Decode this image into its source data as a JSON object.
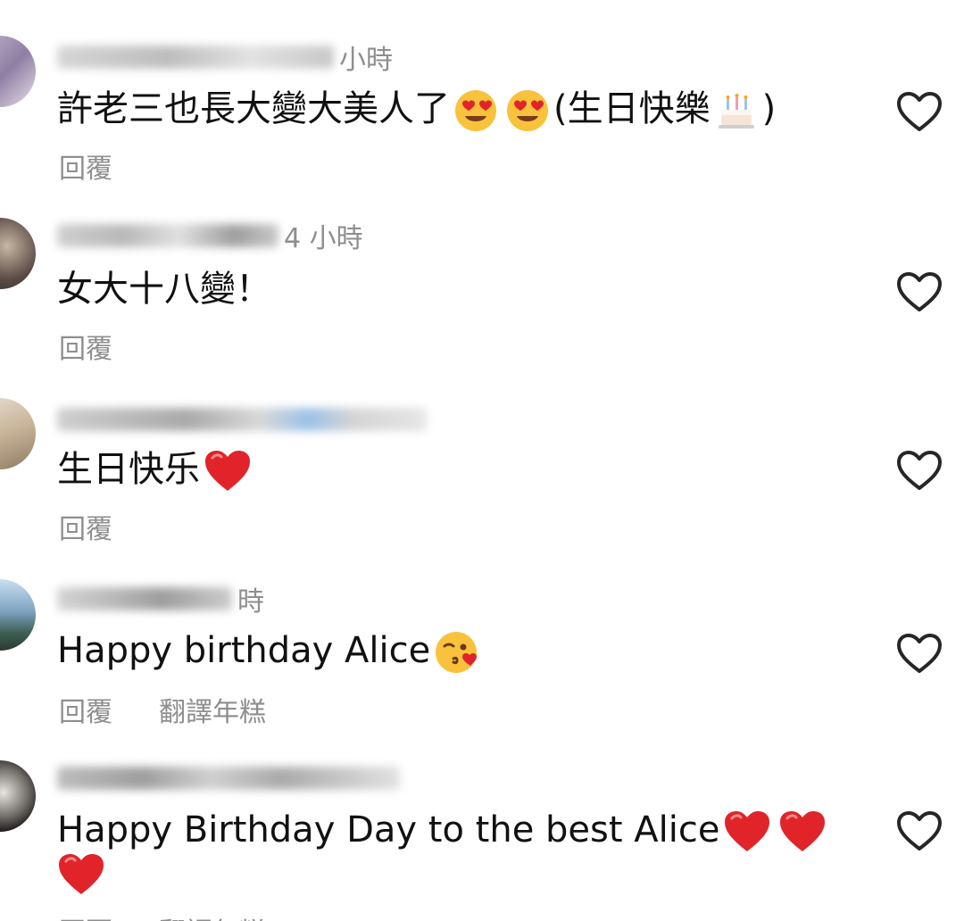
{
  "comments": [
    {
      "time": "小時",
      "text": "許老三也長大變大美人了",
      "text_suffix": "(生日快樂",
      "text_end": ")",
      "reply_label": "回覆",
      "emojis": [
        "heart-eyes-emoji",
        "heart-eyes-emoji",
        "birthday-cake-emoji"
      ]
    },
    {
      "time": "4 小時",
      "text": "女大十八變！",
      "reply_label": "回覆"
    },
    {
      "time": "",
      "text": "生日快乐",
      "reply_label": "回覆",
      "emojis": [
        "red-heart-emoji"
      ]
    },
    {
      "time": "時",
      "text": "Happy birthday Alice",
      "reply_label": "回覆",
      "translate_label": "翻譯年糕",
      "emojis": [
        "kissing-face-emoji"
      ]
    },
    {
      "time": "",
      "text": "Happy Birthday Day to the best Alice",
      "reply_label": "回覆",
      "translate_label": "翻譯年糕",
      "emojis": [
        "red-heart-emoji",
        "red-heart-emoji",
        "red-heart-emoji"
      ]
    }
  ],
  "colors": {
    "text": "#111111",
    "secondary": "#8e8e8e",
    "heart": "#e0242a",
    "icon": "#262626"
  }
}
